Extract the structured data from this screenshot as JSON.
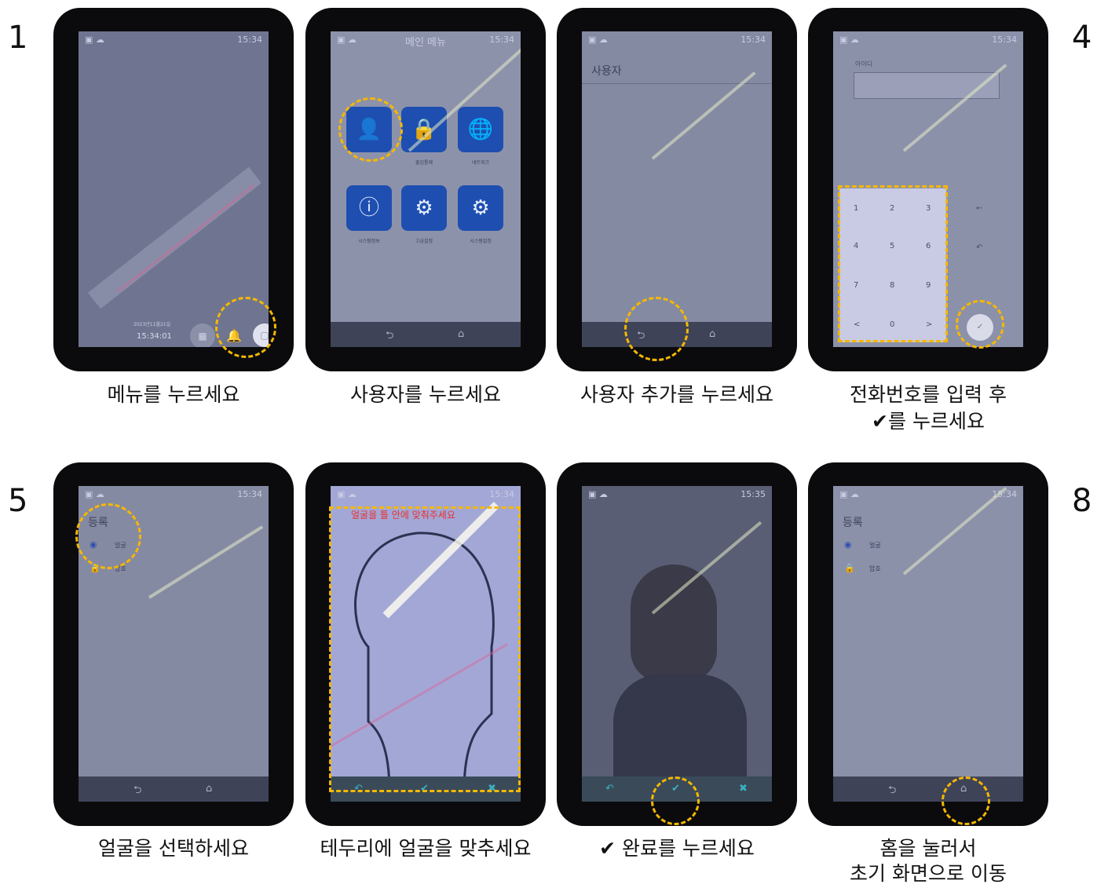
{
  "step_numbers": [
    "1",
    "4",
    "5",
    "8"
  ],
  "screens": {
    "s1": {
      "time": "15:34",
      "date": "2023년11월21일",
      "clock": "15:34:01"
    },
    "s2": {
      "time": "15:34",
      "title": "메인 메뉴",
      "tile_labels": [
        "출입통제",
        "네트워크",
        "시스템정보",
        "고급설정",
        "시스템설정"
      ]
    },
    "s3": {
      "time": "15:34",
      "title": "사용자"
    },
    "s4": {
      "time": "15:34",
      "field_label": "아이디",
      "keys": [
        "1",
        "2",
        "3",
        "4",
        "5",
        "6",
        "7",
        "8",
        "9",
        "<",
        "0",
        ">"
      ],
      "side_keys": [
        "←",
        "↶",
        "✓"
      ]
    },
    "s5": {
      "time": "15:34",
      "title": "등록",
      "items": [
        "얼굴",
        "암호"
      ]
    },
    "s6": {
      "time": "15:34",
      "instruction": "얼굴을 틀 안에 맞춰주세요"
    },
    "s7": {
      "time": "15:35"
    },
    "s8": {
      "time": "15:34",
      "title": "등록",
      "items": [
        "얼굴",
        "암호"
      ]
    }
  },
  "captions": {
    "c1": "메뉴를 누르세요",
    "c2": "사용자를 누르세요",
    "c3": "사용자 추가를 누르세요",
    "c4_line1": "전화번호를 입력 후",
    "c4_line2": "✔를 누르세요",
    "c5": "얼굴을 선택하세요",
    "c6": "테두리에 얼굴을 맞추세요",
    "c7": "✔ 완료를 누르세요",
    "c8_line1": "홈을 눌러서",
    "c8_line2": "초기 화면으로 이동"
  },
  "colors": {
    "highlight": "#f5b800",
    "tile_blue": "#1e4fb0"
  }
}
